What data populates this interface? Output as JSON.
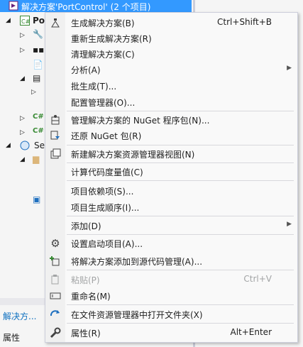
{
  "explorer": {
    "selected_row": "解决方案'PortControl' (2 个项目)",
    "project_label": "Po",
    "se_label": "Se",
    "tab_label": "解决方...",
    "props_label": "属性"
  },
  "menu": {
    "items": [
      {
        "label": "生成解决方案(B)",
        "shortcut": "Ctrl+Shift+B",
        "icon": "build-icon"
      },
      {
        "label": "重新生成解决方案(R)",
        "shortcut": "",
        "icon": ""
      },
      {
        "label": "清理解决方案(C)",
        "shortcut": "",
        "icon": ""
      },
      {
        "label": "分析(A)",
        "shortcut": "",
        "icon": "",
        "submenu": true
      },
      {
        "label": "批生成(T)...",
        "shortcut": "",
        "icon": ""
      },
      {
        "label": "配置管理器(O)...",
        "shortcut": "",
        "icon": ""
      },
      {
        "label": "管理解决方案的 NuGet 程序包(N)...",
        "shortcut": "",
        "icon": "nuget-icon"
      },
      {
        "label": "还原 NuGet 包(R)",
        "shortcut": "",
        "icon": "restore-icon"
      },
      {
        "label": "新建解决方案资源管理器视图(N)",
        "shortcut": "",
        "icon": "new-view-icon"
      },
      {
        "label": "计算代码度量值(C)",
        "shortcut": "",
        "icon": ""
      },
      {
        "label": "项目依赖项(S)...",
        "shortcut": "",
        "icon": ""
      },
      {
        "label": "项目生成顺序(I)...",
        "shortcut": "",
        "icon": ""
      },
      {
        "label": "添加(D)",
        "shortcut": "",
        "icon": "",
        "submenu": true
      },
      {
        "label": "设置启动项目(A)...",
        "shortcut": "",
        "icon": "gear-icon"
      },
      {
        "label": "将解决方案添加到源代码管理(A)...",
        "shortcut": "",
        "icon": "add-source-control-icon"
      },
      {
        "label": "粘贴(P)",
        "shortcut": "Ctrl+V",
        "icon": "paste-icon",
        "disabled": true
      },
      {
        "label": "重命名(M)",
        "shortcut": "",
        "icon": "rename-icon"
      },
      {
        "label": "在文件资源管理器中打开文件夹(X)",
        "shortcut": "",
        "icon": "open-folder-icon"
      },
      {
        "label": "属性(R)",
        "shortcut": "Alt+Enter",
        "icon": "wrench-icon"
      }
    ]
  }
}
